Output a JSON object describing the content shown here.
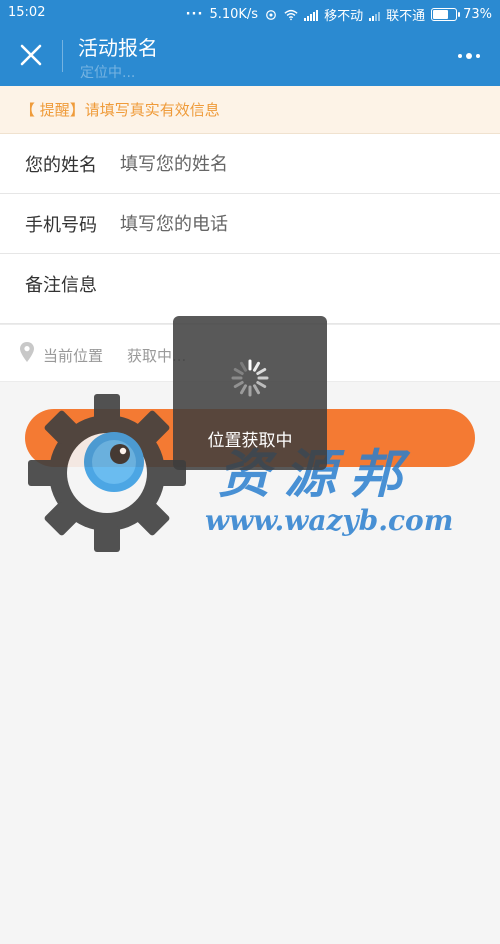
{
  "status_bar": {
    "time": "15:02",
    "network_speed": "5.10K/s",
    "carrier1": "移不动",
    "carrier2": "联不通",
    "battery": "73%",
    "battery_level": 0.73
  },
  "header": {
    "title": "活动报名",
    "subtitle": "定位中..."
  },
  "notice": "【 提醒】请填写真实有效信息",
  "form": {
    "name": {
      "label": "您的姓名",
      "placeholder": "填写您的姓名",
      "value": ""
    },
    "phone": {
      "label": "手机号码",
      "placeholder": "填写您的电话",
      "value": ""
    },
    "remark": {
      "label": "备注信息"
    }
  },
  "location": {
    "label": "当前位置",
    "status": "获取中..."
  },
  "submit_label": "",
  "toast": {
    "text": "位置获取中"
  },
  "watermark": {
    "name": "资源邦",
    "url": "www.wazyb.com"
  },
  "colors": {
    "header_bg": "#2b8ad1",
    "notice_text": "#ef9b3a",
    "notice_bg": "#fdf3e7",
    "button": "#f47a33",
    "watermark": "#2a7fcf"
  },
  "icons": [
    "close-icon",
    "more-icon",
    "location-pin-icon",
    "loading-spinner-icon",
    "signal-icon",
    "wifi-icon",
    "battery-icon"
  ]
}
